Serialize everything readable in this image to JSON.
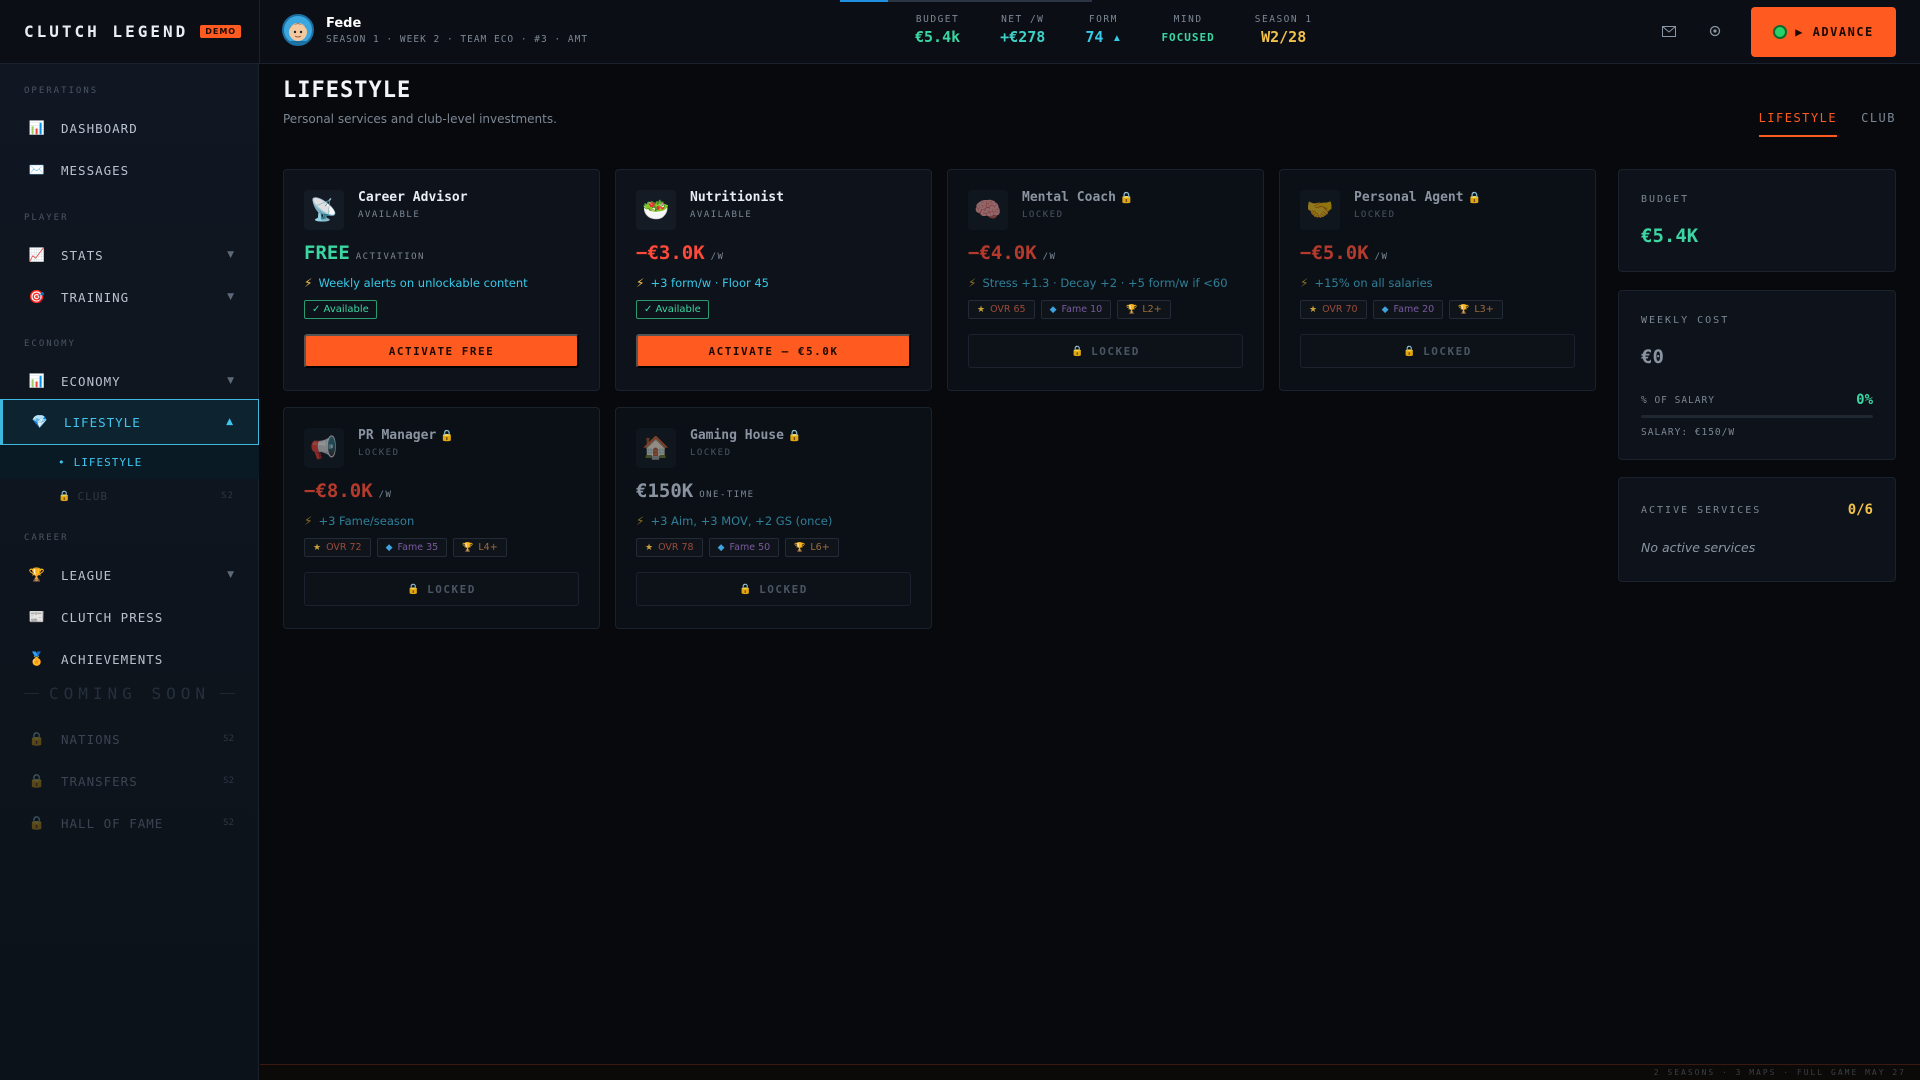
{
  "brand": {
    "name": "CLUTCH LEGEND",
    "badge": "DEMO"
  },
  "profile": {
    "name": "Fede",
    "subtitle": "SEASON 1 · WEEK 2 · TEAM ECO · #3 · AMT"
  },
  "stats": [
    {
      "label": "BUDGET",
      "value": "€5.4k"
    },
    {
      "label": "NET /W",
      "value": "+€278"
    },
    {
      "label": "FORM",
      "value": "74 ▴"
    },
    {
      "label": "MIND",
      "value": "FOCUSED"
    },
    {
      "label": "SEASON 1",
      "value": "W2/28"
    }
  ],
  "header": {
    "advance_label": "▶ ADVANCE"
  },
  "icons": {
    "mail": "mail-icon",
    "settings": "gear-icon"
  },
  "sidebar": {
    "sections": {
      "operations": "OPERATIONS",
      "player": "PLAYER",
      "economy": "ECONOMY",
      "career": "CAREER"
    },
    "items": {
      "dashboard": "DASHBOARD",
      "messages": "MESSAGES",
      "stats": "STATS",
      "training": "TRAINING",
      "economy": "ECONOMY",
      "lifestyle": "LIFESTYLE",
      "lifestyle_sub": "LIFESTYLE",
      "club_sub": "CLUB",
      "club_sub_tag": "S2",
      "league": "LEAGUE",
      "clutch_press": "CLUTCH PRESS",
      "achievements": "ACHIEVEMENTS",
      "nations": "NATIONS",
      "transfers": "TRANSFERS",
      "hall_of_fame": "HALL OF FAME",
      "soon_tag": "S2"
    },
    "coming_soon": "COMING SOON"
  },
  "page": {
    "title": "LIFESTYLE",
    "subtitle": "Personal services and club-level investments.",
    "tabs": [
      "LIFESTYLE",
      "CLUB"
    ]
  },
  "cards": {
    "career_advisor": {
      "name": "Career Advisor",
      "state": "AVAILABLE",
      "price": "FREE",
      "unit": "ACTIVATION",
      "effect": "Weekly alerts on unlockable content",
      "badge": "✓ Available",
      "button": "ACTIVATE FREE"
    },
    "nutritionist": {
      "name": "Nutritionist",
      "state": "AVAILABLE",
      "price": "−€3.0K",
      "unit": "/W",
      "effect": "+3 form/w · Floor 45",
      "badge": "✓ Available",
      "button": "ACTIVATE — €5.0K"
    },
    "mental_coach": {
      "name": "Mental Coach",
      "state": "LOCKED",
      "price": "−€4.0K",
      "unit": "/W",
      "effect": "Stress +1.3 · Decay +2 · +5 form/w if <60",
      "reqs": [
        "OVR 65",
        "Fame 10",
        "L2+"
      ],
      "button": "LOCKED"
    },
    "personal_agent": {
      "name": "Personal Agent",
      "state": "LOCKED",
      "price": "−€5.0K",
      "unit": "/W",
      "effect": "+15% on all salaries",
      "reqs": [
        "OVR 70",
        "Fame 20",
        "L3+"
      ],
      "button": "LOCKED"
    },
    "pr_manager": {
      "name": "PR Manager",
      "state": "LOCKED",
      "price": "−€8.0K",
      "unit": "/W",
      "effect": "+3 Fame/season",
      "reqs": [
        "OVR 72",
        "Fame 35",
        "L4+"
      ],
      "button": "LOCKED"
    },
    "gaming_house": {
      "name": "Gaming House",
      "state": "LOCKED",
      "price": "€150K",
      "unit": "ONE-TIME",
      "effect": "+3 Aim, +3 MOV, +2 GS (once)",
      "reqs": [
        "OVR 78",
        "Fame 50",
        "L6+"
      ],
      "button": "LOCKED"
    }
  },
  "summary": {
    "budget_label": "BUDGET",
    "budget_value": "€5.4K",
    "weekly_label": "WEEKLY COST",
    "weekly_value": "€0",
    "pct_label": "% OF SALARY",
    "pct_value": "0%",
    "salary": "SALARY: €150/W",
    "active_label": "ACTIVE SERVICES",
    "active_count": "0/6",
    "active_empty": "No active services"
  },
  "footer": {
    "text": "2 SEASONS · 3 MAPS · FULL GAME MAY 27"
  },
  "colors": {
    "accent": "#ff5a1f",
    "cyan": "#3fc6ef",
    "green": "#3bd6a2",
    "yellow": "#f2c14a"
  }
}
